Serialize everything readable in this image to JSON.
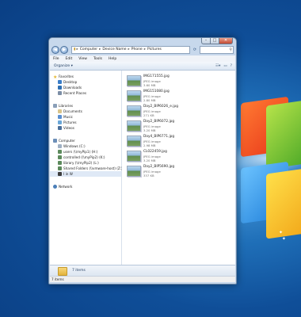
{
  "window": {
    "address": [
      "Computer",
      "Device Name",
      "Phone",
      "Pictures"
    ],
    "nav_back_icon": "arrow-left-icon",
    "nav_forward_icon": "arrow-right-icon"
  },
  "menu": [
    "File",
    "Edit",
    "View",
    "Tools",
    "Help"
  ],
  "toolbar": {
    "organize": "Organize ▾"
  },
  "sidebar": {
    "favorites_header": "Favorites",
    "favorites": [
      "Desktop",
      "Downloads",
      "Recent Places"
    ],
    "libraries_header": "Libraries",
    "libraries": [
      "Documents",
      "Music",
      "Pictures",
      "Videos"
    ],
    "computer_header": "Computer",
    "computer": [
      "Windows (C:)",
      "users (\\\\myPip1) (H:)",
      "controlled (\\\\myPip2) (K:)",
      "library (\\\\myPip2) (L:)",
      "Shared Folders (\\\\vmware-host) (Z:)",
      "I in W"
    ],
    "network_header": "Network"
  },
  "files": [
    {
      "name": "IMG171555.jpg",
      "type": "JPEG image",
      "size": "3.60 MB"
    },
    {
      "name": "IMG151080.jpg",
      "type": "JPEG image",
      "size": "2.80 MB"
    },
    {
      "name": "Day2_BIP6026_e.jpg",
      "type": "JPEG image",
      "size": "271 KB"
    },
    {
      "name": "Day2_BIP6072.jpg",
      "type": "JPEG image",
      "size": "3.20 MB"
    },
    {
      "name": "Day4_BIP6771.jpg",
      "type": "JPEG image",
      "size": "2.98 MB"
    },
    {
      "name": "CL022459.jpg",
      "type": "JPEG image",
      "size": "3.20 MB"
    },
    {
      "name": "Day2_BIP5690.jpg",
      "type": "JPEG image",
      "size": "337 KB"
    }
  ],
  "details": {
    "count": "7 items"
  },
  "status": {
    "text": "7 items"
  },
  "colors": {
    "desktop": "#1f6fb8",
    "window_frame": "#c7d8ec",
    "selection": "#dfe9f6"
  }
}
